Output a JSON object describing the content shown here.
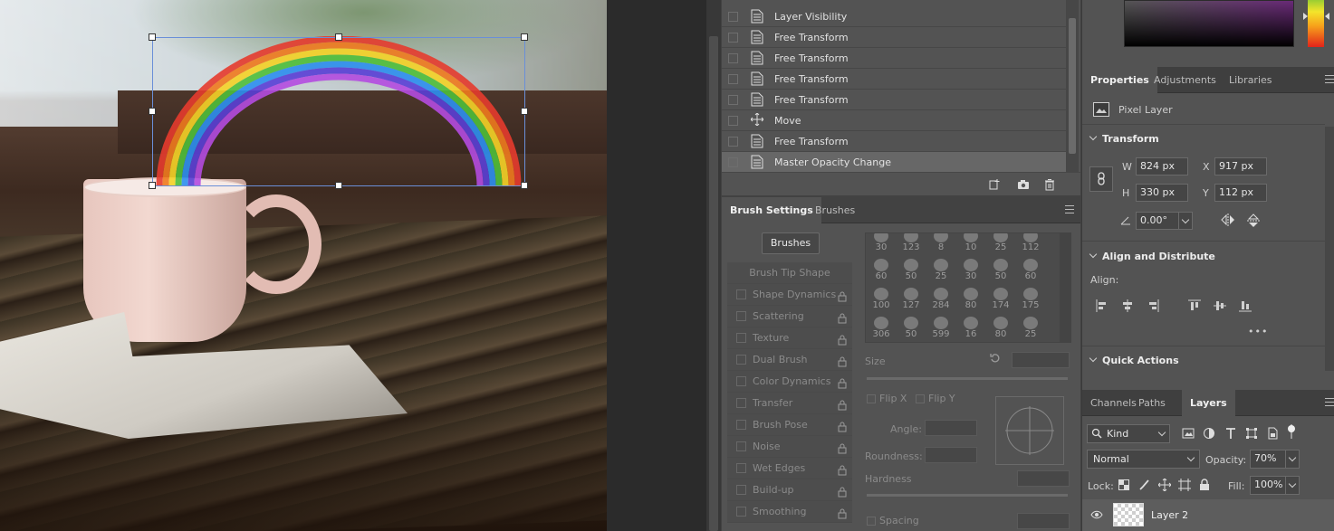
{
  "history": {
    "items": [
      {
        "label": "Layer Visibility"
      },
      {
        "label": "Free Transform"
      },
      {
        "label": "Free Transform"
      },
      {
        "label": "Free Transform"
      },
      {
        "label": "Free Transform"
      },
      {
        "label": "Move"
      },
      {
        "label": "Free Transform"
      },
      {
        "label": "Master Opacity Change"
      }
    ],
    "footer_icons": [
      "new-document-from-state-icon",
      "camera-snapshot-icon",
      "trash-icon"
    ]
  },
  "brush_panel": {
    "tabs": [
      "Brush Settings",
      "Brushes"
    ],
    "brushes_button": "Brushes",
    "options": [
      "Brush Tip Shape",
      "Shape Dynamics",
      "Scattering",
      "Texture",
      "Dual Brush",
      "Color Dynamics",
      "Transfer",
      "Brush Pose",
      "Noise",
      "Wet Edges",
      "Build-up",
      "Smoothing"
    ],
    "tip_sizes": [
      "30",
      "123",
      "8",
      "10",
      "25",
      "112",
      "60",
      "50",
      "25",
      "30",
      "50",
      "60",
      "100",
      "127",
      "284",
      "80",
      "174",
      "175",
      "306",
      "50",
      "599",
      "16",
      "80",
      "25"
    ],
    "size_label": "Size",
    "flip_x": "Flip X",
    "flip_y": "Flip Y",
    "angle_label": "Angle:",
    "roundness_label": "Roundness:",
    "hardness_label": "Hardness",
    "spacing_label": "Spacing"
  },
  "properties": {
    "tabs": [
      "Properties",
      "Adjustments",
      "Libraries"
    ],
    "layer_type": "Pixel Layer",
    "transform_title": "Transform",
    "w_label": "W",
    "w_value": "824 px",
    "h_label": "H",
    "h_value": "330 px",
    "x_label": "X",
    "x_value": "917 px",
    "y_label": "Y",
    "y_value": "112 px",
    "angle_value": "0.00°",
    "align_title": "Align and Distribute",
    "align_label": "Align:",
    "more": "•••",
    "quick_actions_title": "Quick Actions"
  },
  "layers": {
    "tabs": [
      "Channels",
      "Paths",
      "Layers"
    ],
    "filter_kind": "Kind",
    "blend_mode": "Normal",
    "opacity_label": "Opacity:",
    "opacity_value": "70%",
    "lock_label": "Lock:",
    "fill_label": "Fill:",
    "fill_value": "100%",
    "layer_name": "Layer 2"
  },
  "colors": {
    "accent_selection": "#6a8fd8",
    "panel_bg": "#535353",
    "active_row": "#676767"
  }
}
